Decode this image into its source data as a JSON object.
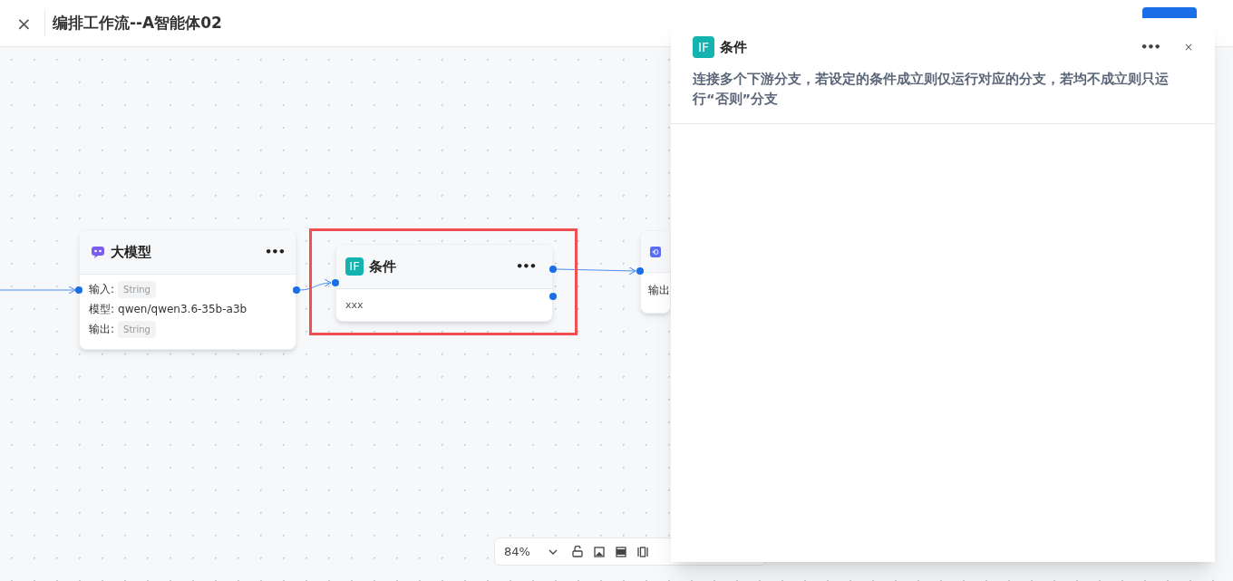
{
  "header": {
    "close": "×",
    "title": "编排工作流--A智能体02"
  },
  "nodes": [
    {
      "kind": "llm",
      "title": "大模型",
      "more": "•••",
      "fields": [
        {
          "label": "输入:",
          "value": "String",
          "kind": "tag"
        },
        {
          "label": "模型:",
          "value": "qwen/qwen3.6-35b-a3b",
          "kind": "text"
        },
        {
          "label": "输出:",
          "value": "String",
          "kind": "tag"
        }
      ],
      "highlighted": false
    },
    {
      "kind": "condition",
      "icon": "IF",
      "title": "条件",
      "more": "•••",
      "body": "xxx",
      "highlighted": true
    },
    {
      "kind": "output",
      "label": "输出"
    }
  ],
  "toolbar": {
    "zoom": "84%"
  },
  "panel": {
    "icon": "IF",
    "title": "条件",
    "more": "•••",
    "close": "×",
    "description": "连接多个下游分支，若设定的条件成立则仅运行对应的分支，若均不成立则只运行“否则”分支"
  }
}
